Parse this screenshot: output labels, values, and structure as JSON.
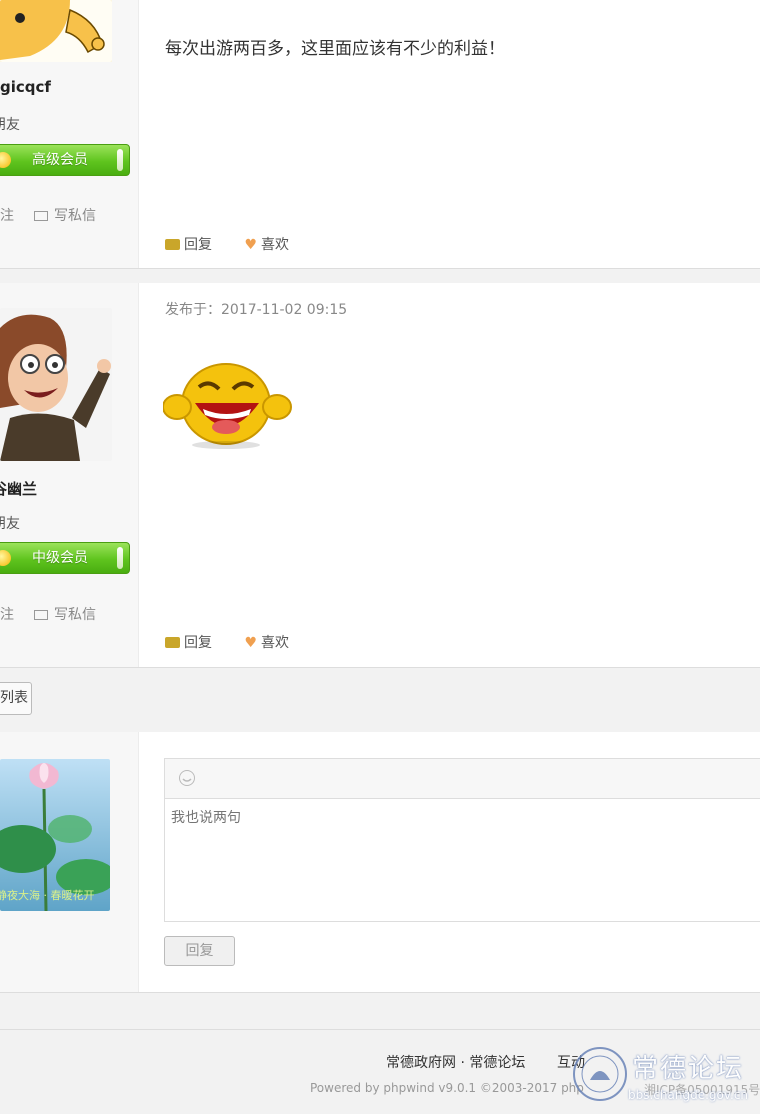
{
  "posts": [
    {
      "username": "gicqcf",
      "group": "朋友",
      "level_badge": "高级会员",
      "follow_label": "关注",
      "message_label": "写私信",
      "content": "每次出游两百多，这里面应该有不少的利益！",
      "reply_label": "回复",
      "like_label": "喜欢"
    },
    {
      "username": "谷幽兰",
      "group": "朋友",
      "level_badge": "中级会员",
      "follow_label": "关注",
      "message_label": "写私信",
      "posted_label": "发布于：2017-11-02 09:15",
      "reply_label": "回复",
      "like_label": "喜欢"
    }
  ],
  "toolbar": {
    "back_to_list": "列表"
  },
  "reply_box": {
    "avatar_caption": "静夜大海 · 春暖花开",
    "placeholder": "我也说两句",
    "submit_label": "回复"
  },
  "footer": {
    "links": "常德政府网 · 常德论坛",
    "interact": "互动",
    "powered": "Powered by phpwind v9.0.1 ©2003-2017 php",
    "icp": "湘ICP备05001915号",
    "logo_text": "常德论坛",
    "logo_url": "bbs.changde.gov.cn"
  }
}
